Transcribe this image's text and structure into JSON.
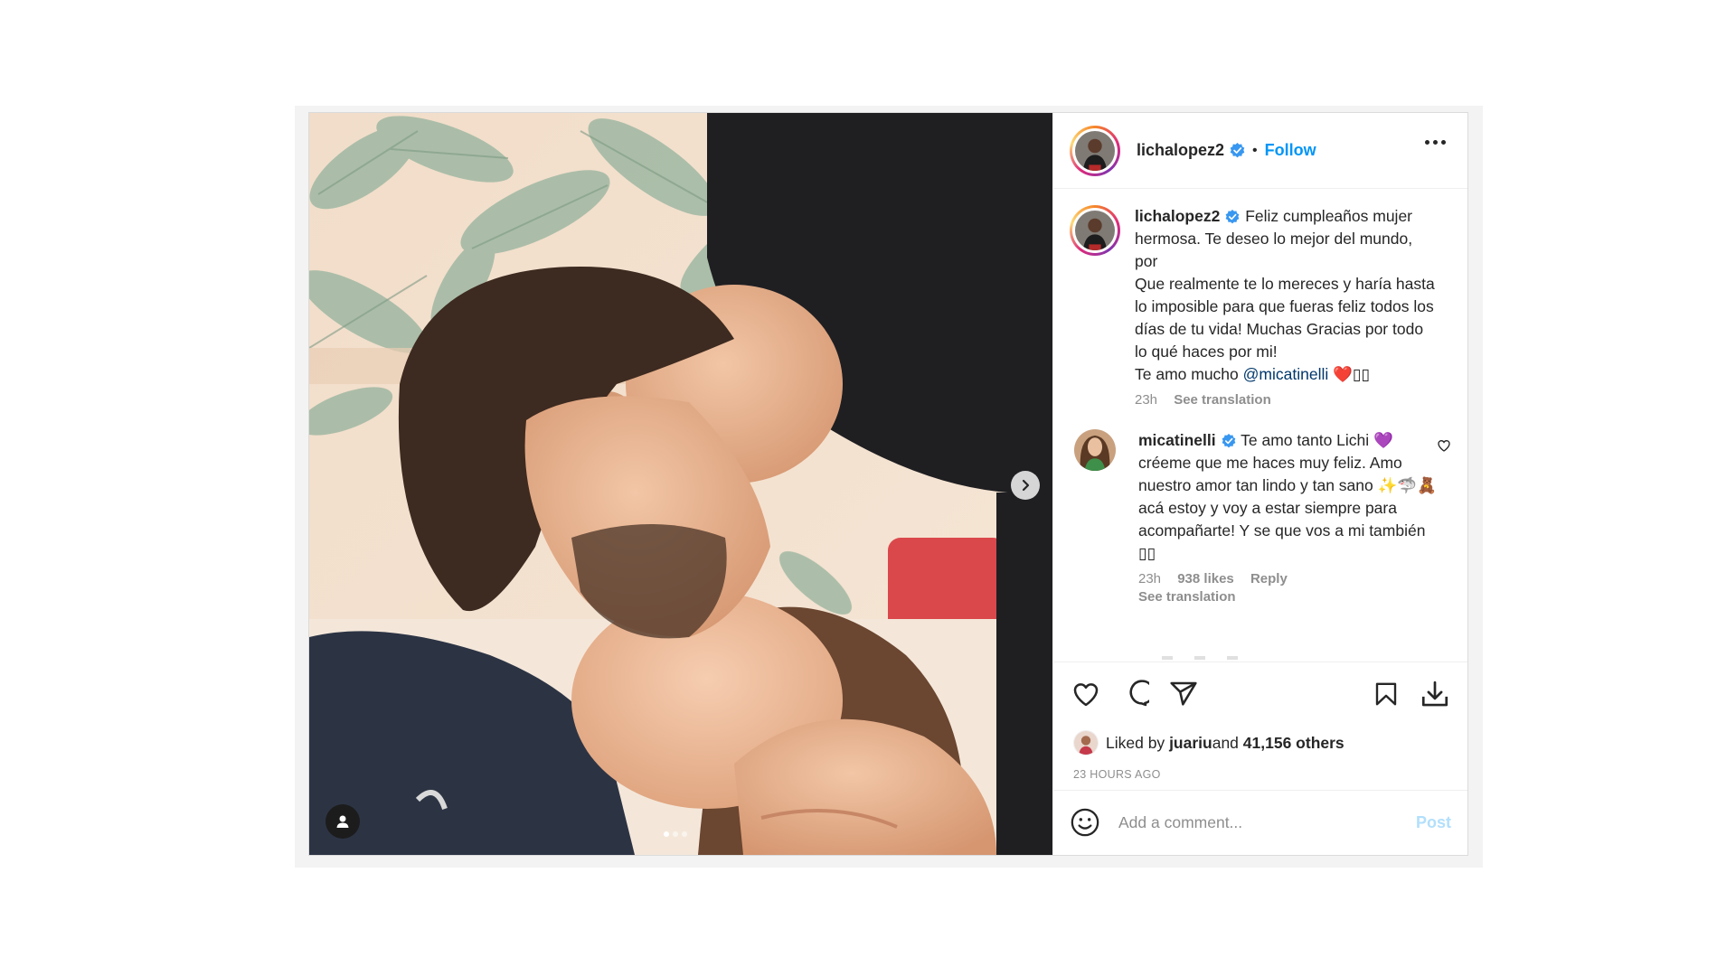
{
  "post": {
    "username": "lichalopez2",
    "follow_label": "Follow",
    "separator": "•",
    "caption": {
      "username": "lichalopez2",
      "line1": " Feliz cumpleaños mujer hermosa. Te deseo lo mejor del mundo, por",
      "line2": "Que realmente te lo mereces y haría hasta lo imposible para que fueras feliz todos los días de tu vida! Muchas Gracias por todo lo qué haces por mi!",
      "line3_prefix": "Te amo mucho ",
      "mention": "@micatinelli",
      "emoji": "❤️",
      "trailing": "▯▯",
      "time": "23h",
      "see_translation": "See translation"
    },
    "comment": {
      "username": "micatinelli",
      "text_a": " Te amo tanto Lichi ",
      "purple_heart": "💜",
      "text_b": " créeme que me haces muy feliz. Amo nuestro amor tan lindo y tan sano ",
      "emojis": "✨🦈🧸",
      "text_c": " acá estoy y voy a estar siempre para acompañarte! Y se que vos a mi también ",
      "trailing": "▯▯",
      "time": "23h",
      "likes": "938 likes",
      "reply": "Reply",
      "see_translation": "See translation"
    },
    "liked_by": {
      "prefix": "Liked by ",
      "user": "juariu",
      "and": " and ",
      "others": "41,156 others"
    },
    "timestamp": "23 HOURS AGO",
    "add_comment_placeholder": "Add a comment...",
    "post_label": "Post",
    "carousel": {
      "count": 3,
      "active": 1
    }
  },
  "icons": {
    "verified": "verified-badge-icon",
    "more": "more-options-icon",
    "like": "heart-icon",
    "comment": "comment-icon",
    "share": "share-icon",
    "save": "bookmark-icon",
    "download": "download-icon",
    "emoji": "emoji-icon",
    "next": "chevron-right-icon",
    "tag": "user-tag-icon"
  },
  "colors": {
    "accent": "#0095f6",
    "post_disabled": "#b2dffc",
    "verified": "#3897f0",
    "muted": "#8e8e8e",
    "text": "#262626"
  }
}
